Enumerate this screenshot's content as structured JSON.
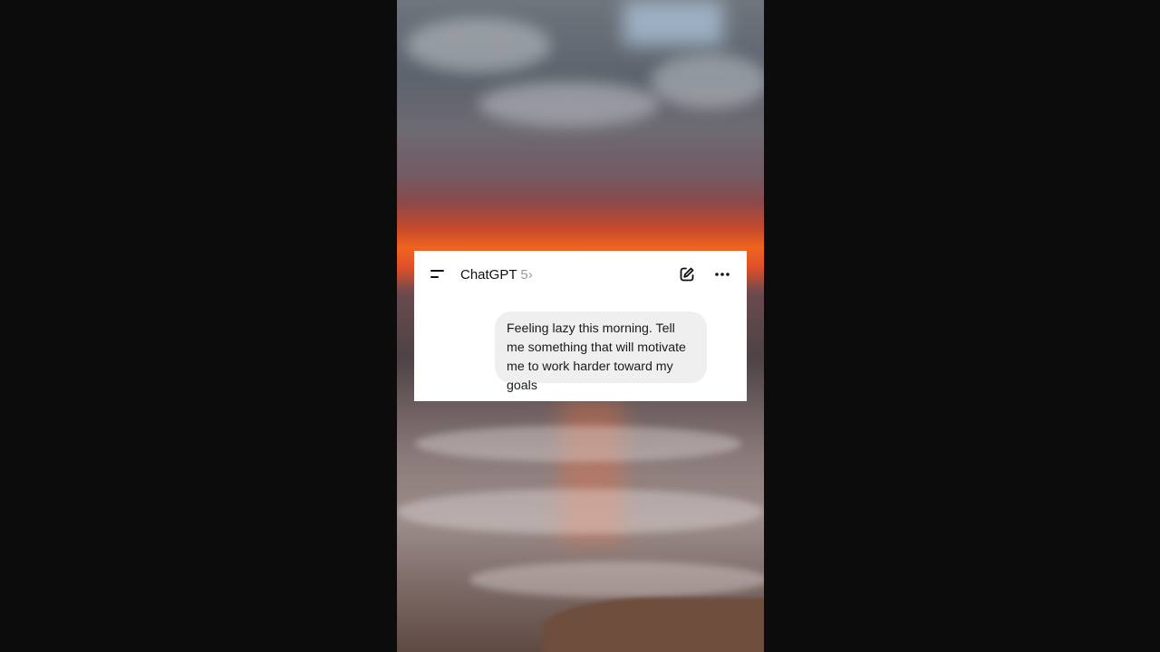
{
  "header": {
    "title": "ChatGPT",
    "version": "5",
    "version_chevron": "›"
  },
  "icons": {
    "menu": "menu-icon",
    "new_chat": "compose-icon",
    "more": "ellipsis-icon"
  },
  "messages": [
    {
      "role": "user",
      "text": "Feeling lazy this morning. Tell me something that will motivate me to work harder toward my goals"
    }
  ]
}
